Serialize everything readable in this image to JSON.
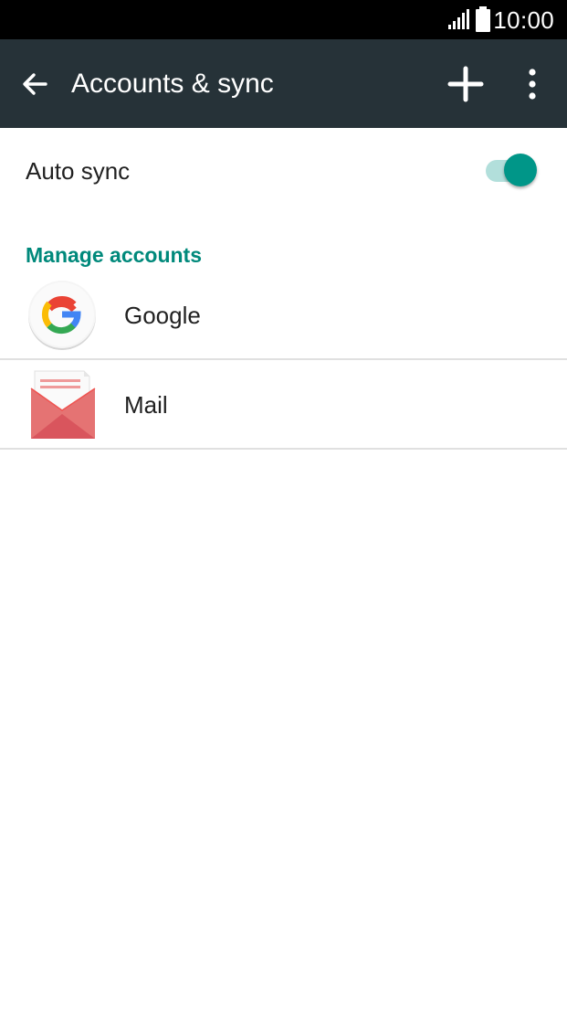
{
  "status_bar": {
    "time": "10:00",
    "icons": [
      "signal-icon",
      "battery-icon"
    ]
  },
  "app_bar": {
    "title": "Accounts & sync",
    "icons": [
      "back-arrow-icon",
      "add-icon",
      "more-vert-icon"
    ]
  },
  "auto_sync": {
    "label": "Auto sync",
    "enabled": true
  },
  "manage_accounts": {
    "header": "Manage accounts",
    "accounts": [
      {
        "name": "Google",
        "icon": "google-icon"
      },
      {
        "name": "Mail",
        "icon": "mail-icon"
      }
    ]
  },
  "colors": {
    "status_bar": "#000000",
    "app_bar": "#263238",
    "accent": "#009688",
    "toggle_track": "#b2dfdb",
    "section_header": "#00897b",
    "divider": "#e0e0e0"
  }
}
